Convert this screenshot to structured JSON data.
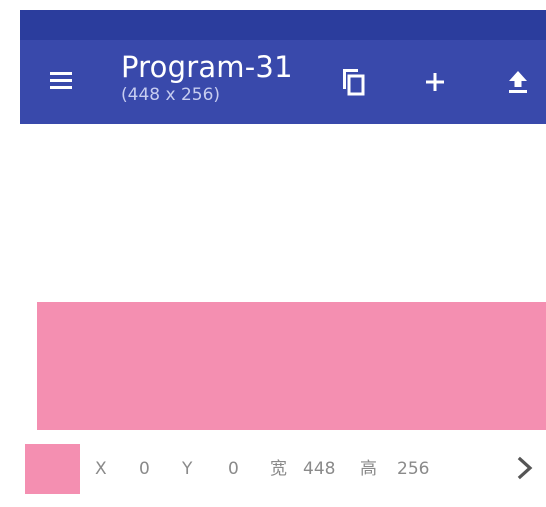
{
  "app_bar": {
    "title": "Program-31",
    "subtitle": "(448 x 256)",
    "menu_icon": "hamburger-menu-icon",
    "actions": [
      {
        "name": "copy",
        "icon": "copy-icon"
      },
      {
        "name": "add",
        "icon": "plus-icon"
      },
      {
        "name": "upload",
        "icon": "upload-icon"
      }
    ]
  },
  "colors": {
    "app_bar": "#3949ab",
    "status_strip": "#2b3d9d",
    "rect_fill": "#f48fb1"
  },
  "properties": {
    "x_label": "X",
    "x_value": "0",
    "y_label": "Y",
    "y_value": "0",
    "width_label": "宽",
    "width_value": "448",
    "height_label": "高",
    "height_value": "256",
    "next_icon": "chevron-right-icon"
  }
}
